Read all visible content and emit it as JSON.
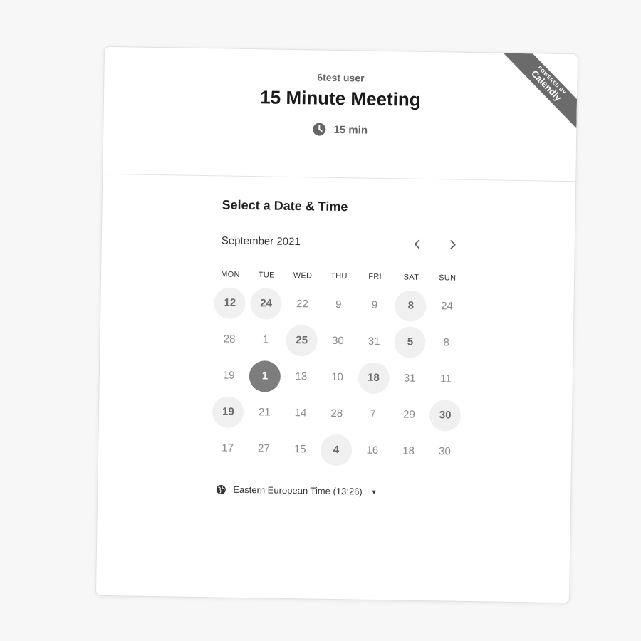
{
  "ribbon": {
    "small": "POWERED BY",
    "brand": "Calendly"
  },
  "event": {
    "owner": "6test user",
    "title": "15 Minute Meeting",
    "duration": "15 min",
    "duration_icon": "clock-icon"
  },
  "scheduler": {
    "heading": "Select a Date & Time",
    "month": "September 2021",
    "prev_icon": "chevron-left-icon",
    "next_icon": "chevron-right-icon",
    "weekdays": [
      "MON",
      "TUE",
      "WED",
      "THU",
      "FRI",
      "SAT",
      "SUN"
    ],
    "days": [
      {
        "label": "12",
        "state": "available"
      },
      {
        "label": "24",
        "state": "available"
      },
      {
        "label": "22",
        "state": "normal"
      },
      {
        "label": "9",
        "state": "normal"
      },
      {
        "label": "9",
        "state": "normal"
      },
      {
        "label": "8",
        "state": "available"
      },
      {
        "label": "24",
        "state": "normal"
      },
      {
        "label": "28",
        "state": "normal"
      },
      {
        "label": "1",
        "state": "normal"
      },
      {
        "label": "25",
        "state": "available"
      },
      {
        "label": "30",
        "state": "normal"
      },
      {
        "label": "31",
        "state": "normal"
      },
      {
        "label": "5",
        "state": "available"
      },
      {
        "label": "8",
        "state": "normal"
      },
      {
        "label": "19",
        "state": "normal"
      },
      {
        "label": "1",
        "state": "selected"
      },
      {
        "label": "13",
        "state": "normal"
      },
      {
        "label": "10",
        "state": "normal"
      },
      {
        "label": "18",
        "state": "available"
      },
      {
        "label": "31",
        "state": "normal"
      },
      {
        "label": "11",
        "state": "normal"
      },
      {
        "label": "19",
        "state": "available"
      },
      {
        "label": "21",
        "state": "normal"
      },
      {
        "label": "14",
        "state": "normal"
      },
      {
        "label": "28",
        "state": "normal"
      },
      {
        "label": "7",
        "state": "normal"
      },
      {
        "label": "29",
        "state": "normal"
      },
      {
        "label": "30",
        "state": "available"
      },
      {
        "label": "17",
        "state": "normal"
      },
      {
        "label": "27",
        "state": "normal"
      },
      {
        "label": "15",
        "state": "normal"
      },
      {
        "label": "4",
        "state": "available"
      },
      {
        "label": "16",
        "state": "normal"
      },
      {
        "label": "18",
        "state": "normal"
      },
      {
        "label": "30",
        "state": "normal"
      }
    ],
    "timezone": "Eastern European Time (13:26)",
    "timezone_icon": "globe-icon"
  }
}
